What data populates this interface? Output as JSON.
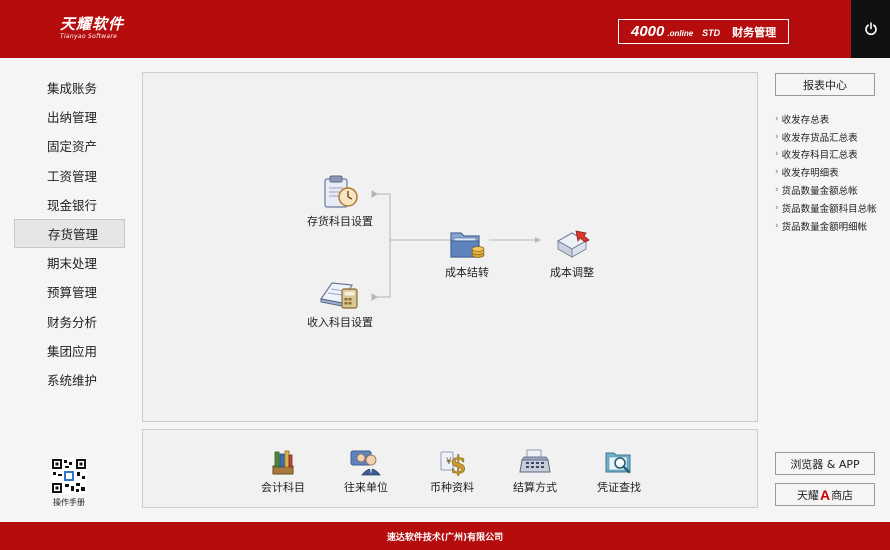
{
  "header": {
    "logo_main": "天耀软件",
    "logo_sub": "Tianyao Software",
    "product_number": "4000",
    "product_edition": ".online",
    "product_std": "STD",
    "product_name": "财务管理",
    "power_icon": "power-icon"
  },
  "nav": {
    "items": [
      {
        "label": "集成账务"
      },
      {
        "label": "出纳管理"
      },
      {
        "label": "固定资产"
      },
      {
        "label": "工资管理"
      },
      {
        "label": "现金银行"
      },
      {
        "label": "存货管理",
        "active": true
      },
      {
        "label": "期末处理"
      },
      {
        "label": "预算管理"
      },
      {
        "label": "财务分析"
      },
      {
        "label": "集团应用"
      },
      {
        "label": "系统维护"
      }
    ]
  },
  "flow": {
    "inventory_subject": {
      "label": "存货科目设置",
      "icon": "clipboard-clock-icon"
    },
    "income_subject": {
      "label": "收入科目设置",
      "icon": "book-calculator-icon"
    },
    "cost_transfer": {
      "label": "成本结转",
      "icon": "folder-coins-icon"
    },
    "cost_adjust": {
      "label": "成本调整",
      "icon": "document-arrow-icon"
    }
  },
  "tools": [
    {
      "label": "会计科目",
      "icon": "accounting-subjects-icon"
    },
    {
      "label": "往来单位",
      "icon": "business-partners-icon"
    },
    {
      "label": "币种资料",
      "icon": "currency-icon"
    },
    {
      "label": "结算方式",
      "icon": "cash-register-icon"
    },
    {
      "label": "凭证查找",
      "icon": "voucher-search-icon"
    }
  ],
  "qr": {
    "label": "操作手册",
    "icon": "qr-code-icon"
  },
  "right": {
    "report_center": "报表中心",
    "links": [
      "收发存总表",
      "收发存货品汇总表",
      "收发存科目汇总表",
      "收发存明细表",
      "货品数量金额总帐",
      "货品数量金额科目总帐",
      "货品数量金额明细帐"
    ],
    "browser_app": "浏览器 & APP",
    "store_prefix": "天耀",
    "store_a": "A",
    "store_suffix": "商店"
  },
  "footer": {
    "text": "速达软件技术(广州)有限公司"
  },
  "colors": {
    "brand_red": "#b50d0d",
    "power_bg": "#111111",
    "panel_bg": "#f1f1f1"
  }
}
